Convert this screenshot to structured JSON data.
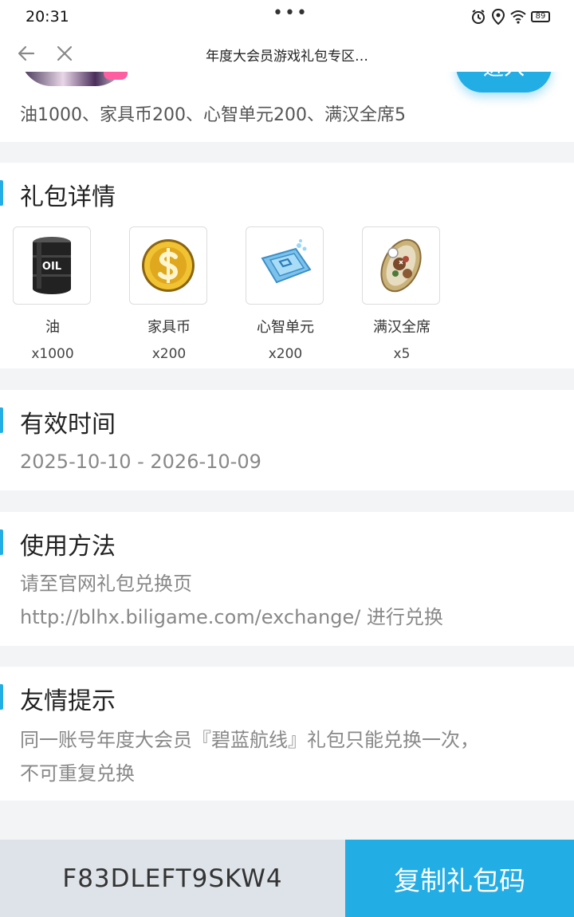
{
  "status": {
    "time": "20:31",
    "dots": "•••",
    "battery": "89"
  },
  "nav": {
    "title": "年度大会员游戏礼包专区…"
  },
  "banner": {
    "summary": "油1000、家具币200、心智单元200、满汉全席5",
    "enter_label": "进入"
  },
  "details": {
    "title": "礼包详情",
    "items": [
      {
        "name": "油",
        "count": "x1000",
        "icon": "oil-barrel-icon"
      },
      {
        "name": "家具币",
        "count": "x200",
        "icon": "furniture-coin-icon"
      },
      {
        "name": "心智单元",
        "count": "x200",
        "icon": "mind-unit-chip-icon"
      },
      {
        "name": "满汉全席",
        "count": "x5",
        "icon": "feast-platter-icon"
      }
    ]
  },
  "validity": {
    "title": "有效时间",
    "range": "2025-10-10 - 2026-10-09"
  },
  "usage": {
    "title": "使用方法",
    "line1": "请至官网礼包兑换页",
    "line2": "http://blhx.biligame.com/exchange/ 进行兑换"
  },
  "tips": {
    "title": "友情提示",
    "line1": "同一账号年度大会员『碧蓝航线』礼包只能兑换一次，",
    "line2": "不可重复兑换"
  },
  "footer": {
    "code": "F83DLEFT9SKW4",
    "copy_label": "复制礼包码"
  },
  "colors": {
    "accent": "#23ade5",
    "code_bg": "#dde3e8",
    "page_bg": "#f2f4f6"
  }
}
